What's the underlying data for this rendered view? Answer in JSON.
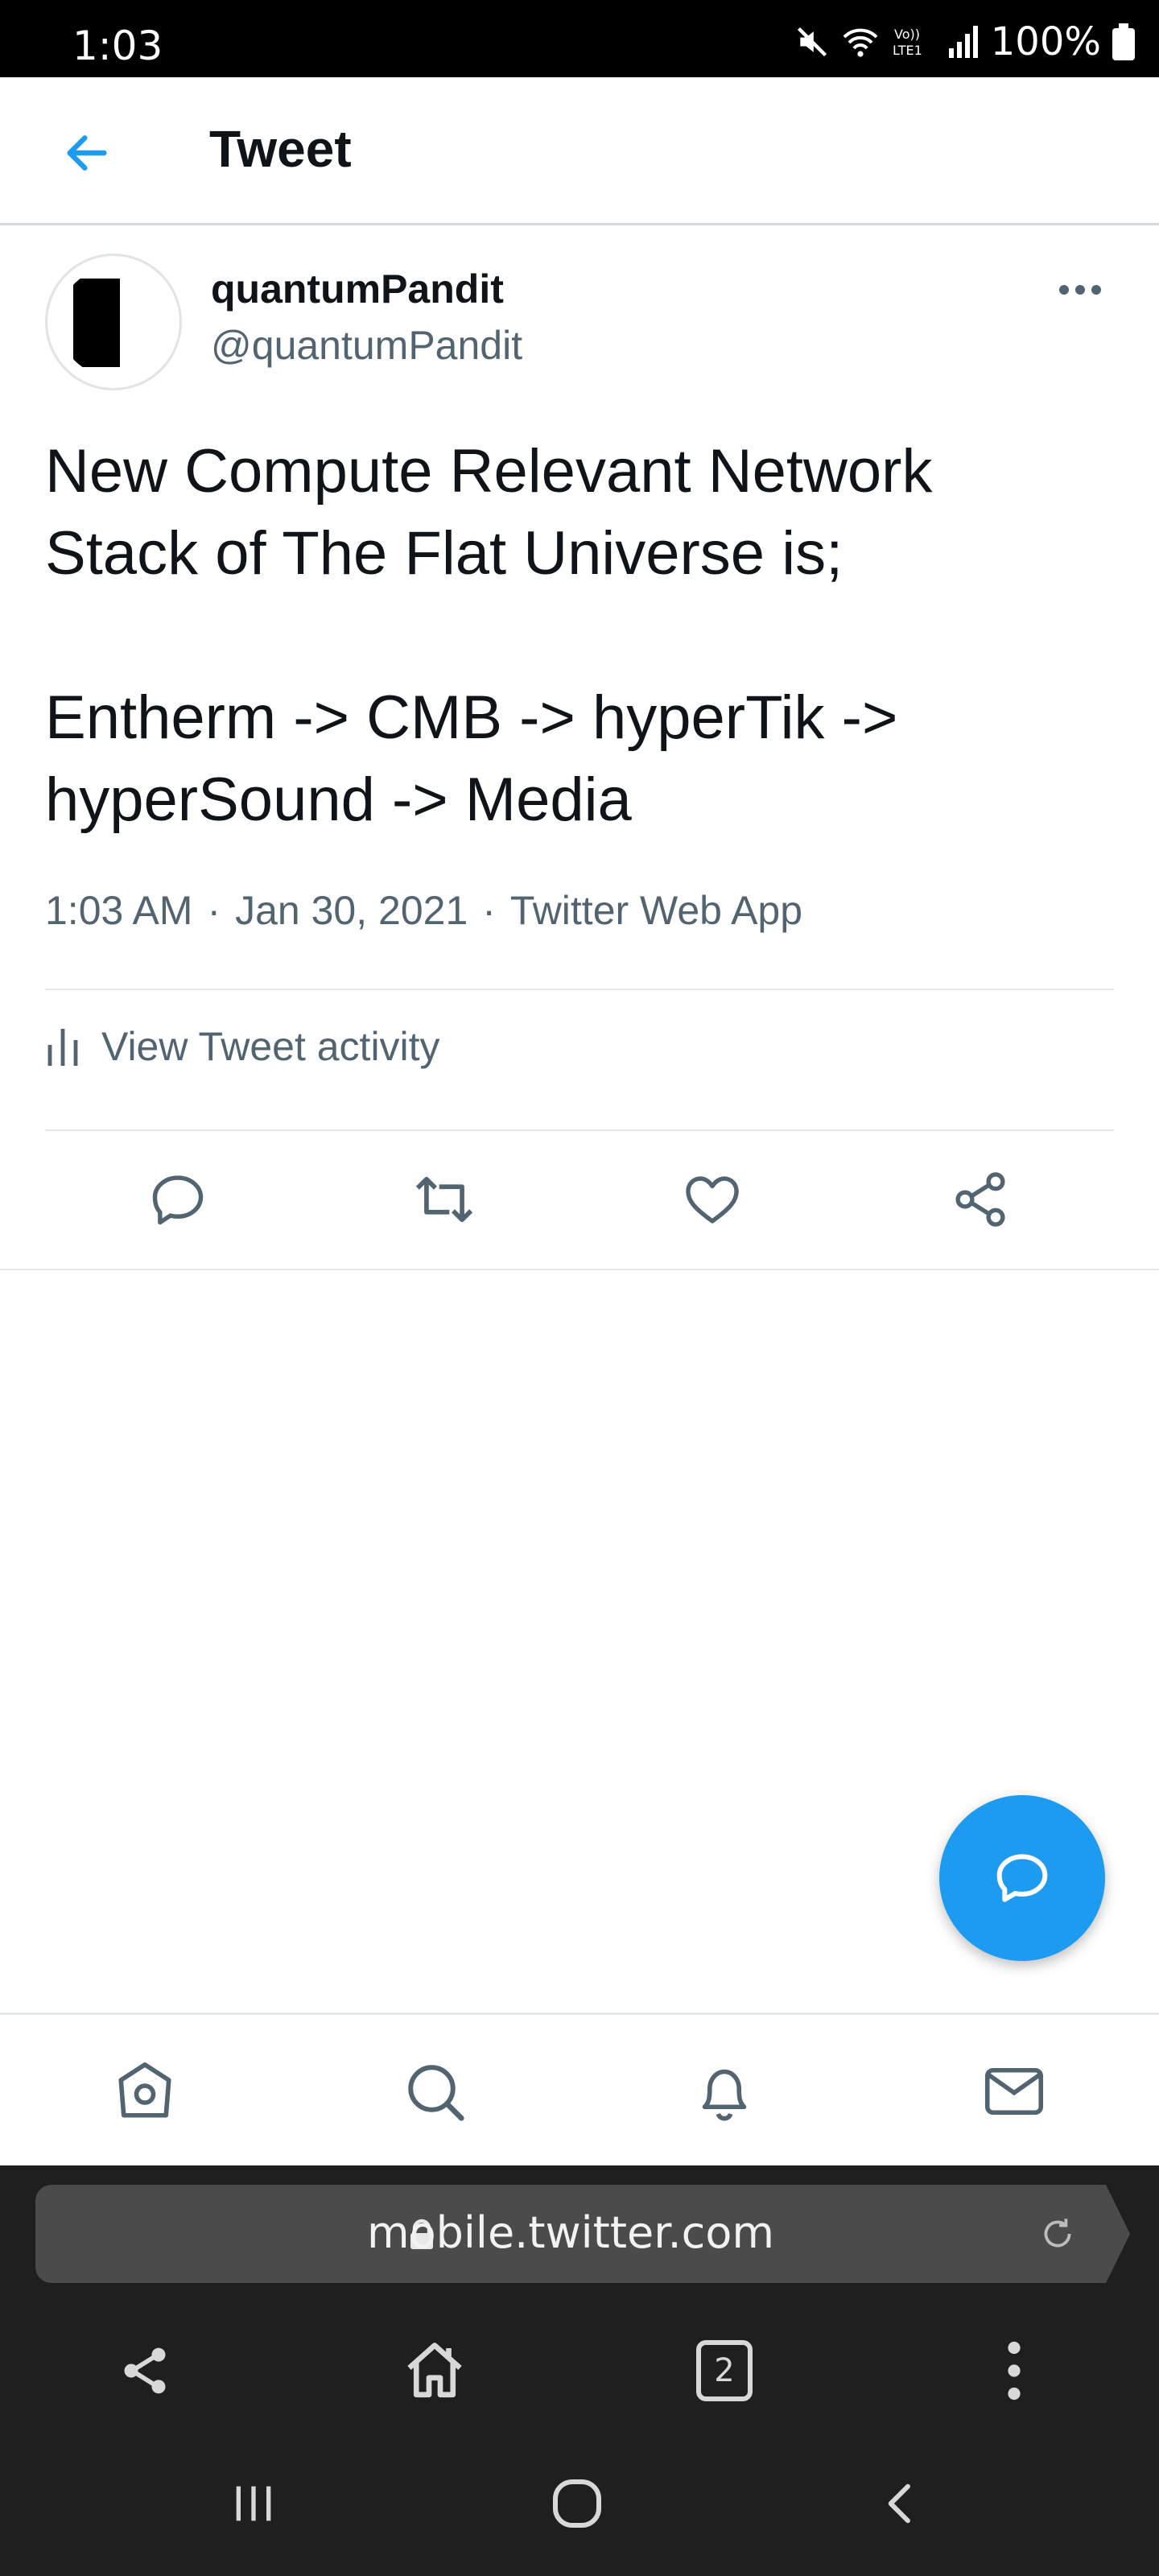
{
  "status_bar": {
    "time": "1:03",
    "battery": "100%"
  },
  "header": {
    "title": "Tweet"
  },
  "tweet": {
    "author_name": "quantumPandit",
    "author_handle": "@quantumPandit",
    "text": "New Compute Relevant Network\nStack of The Flat Universe is;\n\nEntherm -> CMB -> hyperTik ->\nhyperSound -> Media",
    "time": "1:03 AM",
    "date": "Jan 30, 2021",
    "source": "Twitter Web App",
    "separator": "·",
    "activity_label": "View Tweet activity"
  },
  "browser": {
    "url": "mobile.twitter.com",
    "tab_count": "2"
  },
  "colors": {
    "accent": "#1d9bf0",
    "secondary_text": "#536471"
  }
}
